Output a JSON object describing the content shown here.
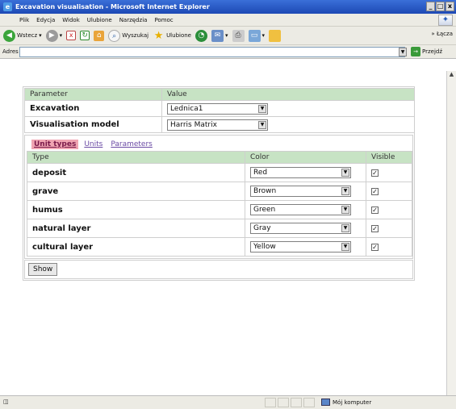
{
  "window": {
    "title": "Excavation visualisation - Microsoft Internet Explorer"
  },
  "menu": [
    "Plik",
    "Edycja",
    "Widok",
    "Ulubione",
    "Narzędzia",
    "Pomoc"
  ],
  "toolbar": {
    "back": "Wstecz",
    "search": "Wyszukaj",
    "favorites": "Ulubione",
    "links": "Łącza"
  },
  "address": {
    "label": "Adres",
    "value": "",
    "go": "Przejdź"
  },
  "status": {
    "zone": "Mój komputer"
  },
  "params": {
    "header": {
      "col1": "Parameter",
      "col2": "Value"
    },
    "rows": [
      {
        "label": "Excavation",
        "value": "Lednica1"
      },
      {
        "label": "Visualisation model",
        "value": "Harris Matrix"
      }
    ]
  },
  "tabs": [
    "Unit types",
    "Units",
    "Parameters"
  ],
  "types": {
    "header": {
      "type": "Type",
      "color": "Color",
      "visible": "Visible"
    },
    "rows": [
      {
        "type": "deposit",
        "color": "Red",
        "visible": true
      },
      {
        "type": "grave",
        "color": "Brown",
        "visible": true
      },
      {
        "type": "humus",
        "color": "Green",
        "visible": true
      },
      {
        "type": "natural layer",
        "color": "Gray",
        "visible": true
      },
      {
        "type": "cultural layer",
        "color": "Yellow",
        "visible": true
      }
    ]
  },
  "show_button": "Show"
}
